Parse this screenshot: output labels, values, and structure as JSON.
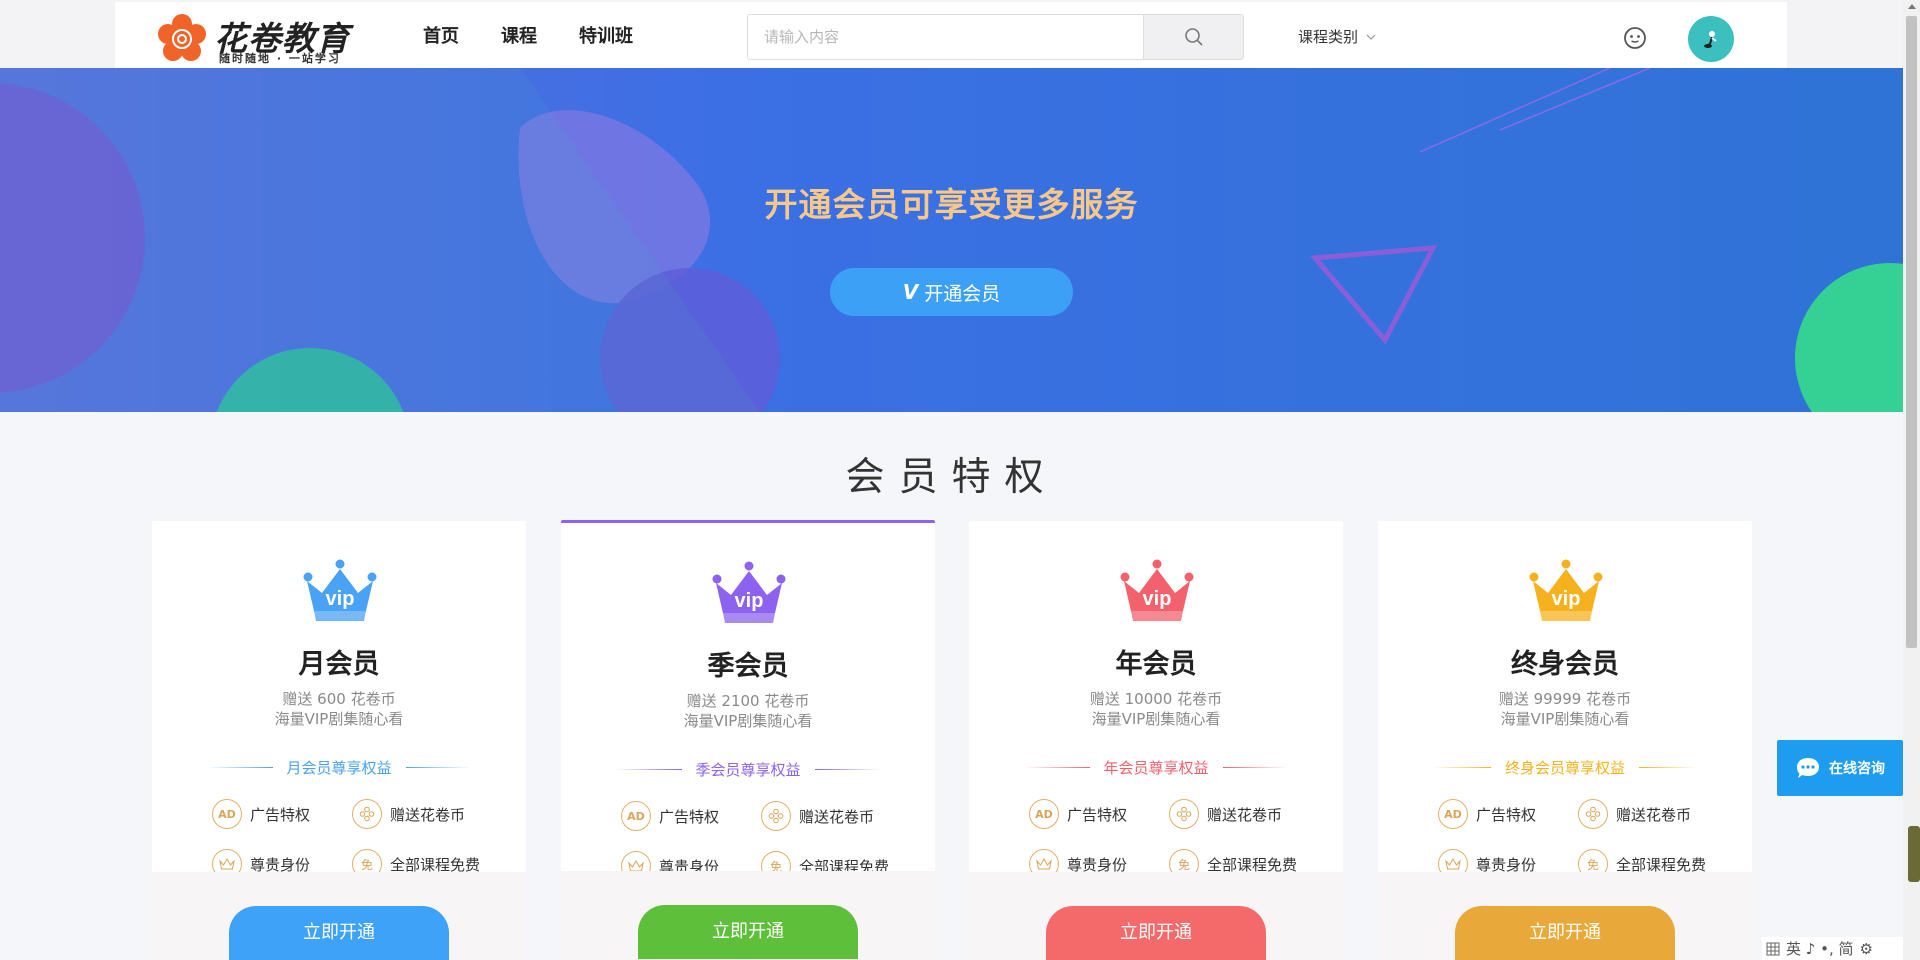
{
  "header": {
    "logo_title": "花卷教育",
    "logo_subtitle": "随时随地 · 一站学习",
    "nav": [
      "首页",
      "课程",
      "特训班"
    ],
    "search_placeholder": "请输入内容",
    "category_label": "课程类别"
  },
  "banner": {
    "title": "开通会员可享受更多服务",
    "button_label": "开通会员",
    "button_vip_mark": "V"
  },
  "section": {
    "title": "会员特权"
  },
  "cards": [
    {
      "name": "月会员",
      "bonus": "赠送 600 花卷币",
      "desc": "海量VIP剧集随心看",
      "rights_title": "月会员尊享权益",
      "accent": "#4aa2f4",
      "button_label": "立即开通",
      "button_color": "#3da2f8"
    },
    {
      "name": "季会员",
      "bonus": "赠送 2100 花卷币",
      "desc": "海量VIP剧集随心看",
      "rights_title": "季会员尊享权益",
      "accent": "#8c62ee",
      "button_label": "立即开通",
      "button_color": "#5ec03a"
    },
    {
      "name": "年会员",
      "bonus": "赠送 10000 花卷币",
      "desc": "海量VIP剧集随心看",
      "rights_title": "年会员尊享权益",
      "accent": "#f2616c",
      "button_label": "立即开通",
      "button_color": "#f46a6a"
    },
    {
      "name": "终身会员",
      "bonus": "赠送 99999 花卷币",
      "desc": "海量VIP剧集随心看",
      "rights_title": "终身会员尊享权益",
      "accent": "#f6b21e",
      "button_label": "立即开通",
      "button_color": "#e8a83a"
    }
  ],
  "features": [
    {
      "label": "广告特权",
      "icon": "AD"
    },
    {
      "label": "赠送花卷币",
      "icon": "coins"
    },
    {
      "label": "尊贵身份",
      "icon": "crown"
    },
    {
      "label": "全部课程免费",
      "icon": "免"
    }
  ],
  "consult_label": "在线咨询",
  "ime": "英 ♪ •, 简"
}
